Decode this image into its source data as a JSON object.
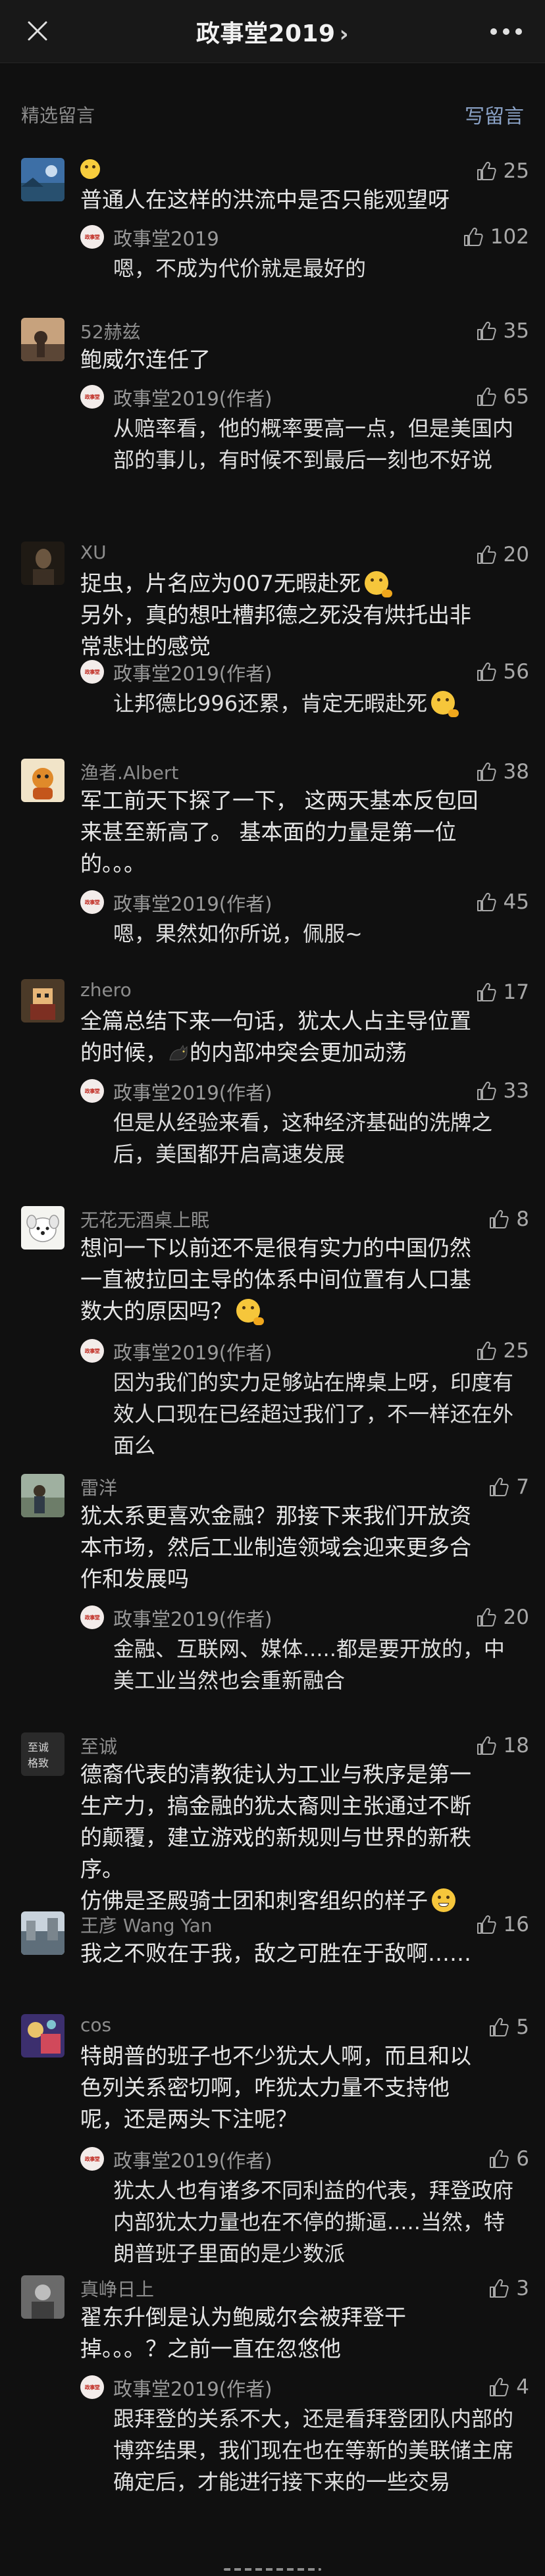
{
  "header": {
    "title": "政事堂2019",
    "chevron": "›"
  },
  "section": {
    "title": "精选留言",
    "write_label": "写留言"
  },
  "reply_logo_text": "政事堂",
  "comments": [
    {
      "nickname": "",
      "avatar": "blue-landscape",
      "emoji_name": "slightly-smiling-emoji",
      "likes": "25",
      "text": "普通人在这样的洪流中是否只能观望呀",
      "reply": {
        "author": "政事堂2019",
        "likes": "102",
        "text": "嗯，不成为代价就是最好的"
      }
    },
    {
      "nickname": "52赫兹",
      "avatar": "sunset-figure",
      "likes": "35",
      "text": "鲍威尔连任了",
      "reply": {
        "author": "政事堂2019(作者)",
        "likes": "65",
        "text": "从赔率看，他的概率要高一点，但是美国内部的事儿，有时候不到最后一刻也不好说"
      }
    },
    {
      "nickname": "XU",
      "avatar": "dark-portrait",
      "likes": "20",
      "text": "捉虫，片名应为007无暇赴死",
      "text_emoji": "face-with-hand-emoji",
      "text_cont": "另外，真的想吐槽邦德之死没有烘托出非常悲壮的感觉",
      "reply": {
        "author": "政事堂2019(作者)",
        "likes": "56",
        "text": "让邦德比996还累，肯定无暇赴死",
        "emoji": "face-with-hand-emoji"
      }
    },
    {
      "nickname": "渔者.Albert",
      "avatar": "cartoon-animal",
      "likes": "38",
      "text": "军工前天下探了一下，  这两天基本反包回来甚至新高了。  基本面的力量是第一位的。。。",
      "reply": {
        "author": "政事堂2019(作者)",
        "likes": "45",
        "text": "嗯，果然如你所说，佩服~"
      }
    },
    {
      "nickname": "zhero",
      "avatar": "pixel-character",
      "likes": "17",
      "text_a": "全篇总结下来一句话，犹太人占主导位置的时候，",
      "inline_icon": "black-cat-icon",
      "text_b": "的内部冲突会更加动荡",
      "reply": {
        "author": "政事堂2019(作者)",
        "likes": "33",
        "text": "但是从经验来看，这种经济基础的洗牌之后，美国都开启高速发展"
      }
    },
    {
      "nickname": "无花无酒桌上眠",
      "avatar": "cartoon-dog",
      "likes": "8",
      "text": "想问一下以前还不是很有实力的中国仍然一直被拉回主导的体系中间位置有人口基数大的原因吗？",
      "text_emoji": "thinking-emoji",
      "reply": {
        "author": "政事堂2019(作者)",
        "likes": "25",
        "text": "因为我们的实力足够站在牌桌上呀，印度有效人口现在已经超过我们了，不一样还在外面么"
      }
    },
    {
      "nickname": "雷洋",
      "avatar": "outdoor-person",
      "likes": "7",
      "text": "犹太系更喜欢金融？那接下来我们开放资本市场，然后工业制造领域会迎来更多合作和发展吗",
      "reply": {
        "author": "政事堂2019(作者)",
        "likes": "20",
        "text": "金融、互联网、媒体.....都是要开放的，中美工业当然也会重新融合"
      }
    },
    {
      "nickname": "至诚",
      "avatar": "calligraphy",
      "likes": "18",
      "text": "德裔代表的清教徒认为工业与秩序是第一生产力，搞金融的犹太裔则主张通过不断的颠覆，建立游戏的新规则与世界的新秩序。",
      "text_cont": "仿佛是圣殿骑士团和刺客组织的样子",
      "text_emoji": "grin-emoji"
    },
    {
      "nickname": "王彦 Wang Yan",
      "avatar": "city-street",
      "likes": "16",
      "text": "我之不败在于我，敌之可胜在于敌啊……"
    },
    {
      "nickname": "cos",
      "avatar": "purple-art",
      "likes": "5",
      "text": "特朗普的班子也不少犹太人啊，而且和以色列关系密切啊，咋犹太力量不支持他呢，还是两头下注呢？",
      "reply": {
        "author": "政事堂2019(作者)",
        "likes": "6",
        "text": "犹太人也有诸多不同利益的代表，拜登政府内部犹太力量也在不停的撕逼.....当然，特朗普班子里面的是少数派"
      }
    },
    {
      "nickname": "真峥日上",
      "avatar": "gray-photo",
      "likes": "3",
      "text": "翟东升倒是认为鲍威尔会被拜登干掉。。。？之前一直在忽悠他",
      "reply": {
        "author": "政事堂2019(作者)",
        "likes": "4",
        "text": "跟拜登的关系不大，还是看拜登团队内部的博弈结果，我们现在也在等新的美联储主席确定后，才能进行接下来的一些交易"
      }
    }
  ]
}
